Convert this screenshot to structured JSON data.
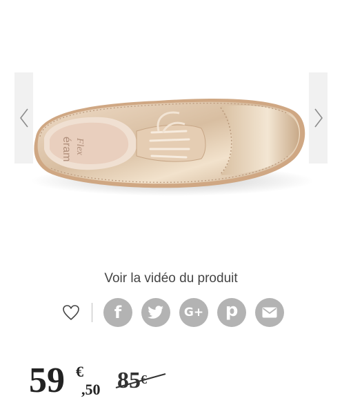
{
  "gallery": {
    "prev_icon": "chevron-left-icon",
    "next_icon": "chevron-right-icon",
    "product_image": "oxford-brogue-shoe-rose-gold",
    "brand_insole_text": "éram",
    "brand_insole_script": "Flex"
  },
  "video_link": "Voir la vidéo du produit",
  "share": {
    "wishlist_icon": "heart-outline-icon",
    "buttons": [
      {
        "icon": "facebook-icon",
        "glyph": "f"
      },
      {
        "icon": "twitter-icon"
      },
      {
        "icon": "google-plus-icon",
        "glyph": "G+"
      },
      {
        "icon": "pinterest-icon",
        "glyph": "p"
      },
      {
        "icon": "email-icon"
      }
    ],
    "button_color": "#b3b3b3"
  },
  "price": {
    "current_int": "59",
    "currency": "€",
    "current_dec": ",50",
    "old_int": "85",
    "old_currency": "€"
  }
}
